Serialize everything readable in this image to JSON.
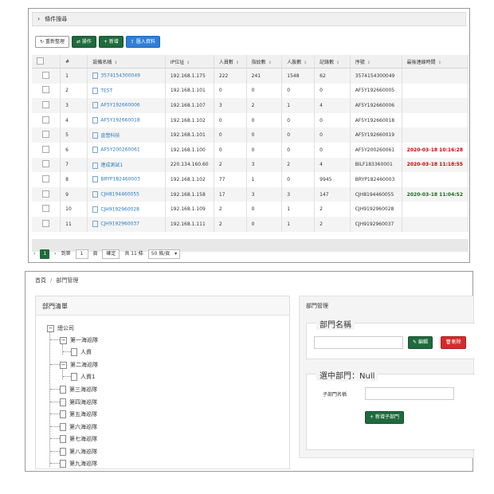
{
  "top": {
    "filter_label": "條件搜尋",
    "toolbar": {
      "reset": "重新整理",
      "export": "操作",
      "add": "新增",
      "import": "匯入資料"
    },
    "columns": [
      "#",
      "設備名稱",
      "IP位址",
      "人員數",
      "指紋數",
      "人臉數",
      "記錄數",
      "序號",
      "最後連線時間"
    ],
    "rows": [
      {
        "n": "1",
        "name": "3574154300049",
        "ip": "192.168.1.175",
        "users": "222",
        "fp": "241",
        "face": "1548",
        "rec": "62",
        "sn": "3574154300049",
        "last": "",
        "lc": ""
      },
      {
        "n": "2",
        "name": "TEST",
        "ip": "192.168.1.101",
        "users": "0",
        "fp": "0",
        "face": "0",
        "rec": "0",
        "sn": "AF5Y192660005",
        "last": "",
        "lc": ""
      },
      {
        "n": "3",
        "name": "AF5Y192660006",
        "ip": "192.168.1.107",
        "users": "3",
        "fp": "2",
        "face": "1",
        "rec": "4",
        "sn": "AF5Y192660006",
        "last": "",
        "lc": ""
      },
      {
        "n": "4",
        "name": "AF5Y192660018",
        "ip": "192.168.1.102",
        "users": "0",
        "fp": "0",
        "face": "0",
        "rec": "0",
        "sn": "AF5Y192660018",
        "last": "",
        "lc": ""
      },
      {
        "n": "5",
        "name": "直營科技",
        "ip": "192.168.1.101",
        "users": "0",
        "fp": "0",
        "face": "0",
        "rec": "0",
        "sn": "AF5Y192660019",
        "last": "",
        "lc": ""
      },
      {
        "n": "6",
        "name": "AF5Y200260061",
        "ip": "192.168.1.100",
        "users": "0",
        "fp": "0",
        "face": "0",
        "rec": "0",
        "sn": "AF5Y200260061",
        "last": "2020-03-18 10:16:28",
        "lc": "red"
      },
      {
        "n": "7",
        "name": "連成測試1",
        "ip": "220.134.160.60",
        "users": "2",
        "fp": "3",
        "face": "2",
        "rec": "4",
        "sn": "BILF183360001",
        "last": "2020-03-18 11:18:55",
        "lc": "red"
      },
      {
        "n": "8",
        "name": "BRYP182460003",
        "ip": "192.168.1.102",
        "users": "77",
        "fp": "1",
        "face": "0",
        "rec": "9945",
        "sn": "BRYP182460003",
        "last": "",
        "lc": ""
      },
      {
        "n": "9",
        "name": "CJH8194460055",
        "ip": "192.168.1.158",
        "users": "17",
        "fp": "3",
        "face": "3",
        "rec": "147",
        "sn": "CJH8194460055",
        "last": "2020-03-18 11:04:52",
        "lc": "grn"
      },
      {
        "n": "10",
        "name": "CJH9192960028",
        "ip": "192.168.1.109",
        "users": "2",
        "fp": "0",
        "face": "1",
        "rec": "2",
        "sn": "CJH9192960028",
        "last": "",
        "lc": ""
      },
      {
        "n": "11",
        "name": "CJH9192960037",
        "ip": "192.168.1.111",
        "users": "2",
        "fp": "0",
        "face": "1",
        "rec": "2",
        "sn": "CJH9192960037",
        "last": "",
        "lc": ""
      }
    ],
    "pager": {
      "current": "1",
      "goto_label": "到第",
      "goto_value": "1",
      "page_unit": "頁",
      "confirm": "確定",
      "total": "共 11 條",
      "per_page": "50 條/頁"
    }
  },
  "bottom": {
    "breadcrumb": [
      "首頁",
      "部門管理"
    ],
    "tree_title": "部門清單",
    "tree": {
      "root": "總公司",
      "n1": "第一海巡隊",
      "n1c": "人資",
      "n2": "第二海巡隊",
      "n2c": "人資1",
      "n3": "第三海巡隊",
      "n4": "第四海巡隊",
      "n5": "第五海巡隊",
      "n6": "第六海巡隊",
      "n7": "第七海巡隊",
      "n8": "第八海巡隊",
      "n9": "第九海巡隊"
    },
    "right_title": "部門管理",
    "dept_name_legend": "部門名稱",
    "edit": "編輯",
    "delete": "刪除",
    "selected_legend": "選中部門：Null",
    "sub_label": "子部門名稱",
    "add_sub": "新增子部門"
  }
}
